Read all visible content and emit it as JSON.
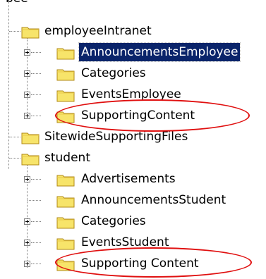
{
  "tree": {
    "top_fragment": "bee",
    "nodes": [
      {
        "label": "employeeIntranet",
        "level": 0,
        "expandable": false
      },
      {
        "label": "AnnouncementsEmployee",
        "level": 1,
        "expandable": true,
        "selected": true
      },
      {
        "label": "Categories",
        "level": 1,
        "expandable": true
      },
      {
        "label": "EventsEmployee",
        "level": 1,
        "expandable": true
      },
      {
        "label": "SupportingContent",
        "level": 1,
        "expandable": true,
        "highlighted": true
      },
      {
        "label": "SitewideSupportingFiles",
        "level": 0,
        "expandable": false
      },
      {
        "label": "student",
        "level": 0,
        "expandable": false
      },
      {
        "label": "Advertisements",
        "level": 1,
        "expandable": true
      },
      {
        "label": "AnnouncementsStudent",
        "level": 1,
        "expandable": false
      },
      {
        "label": "Categories",
        "level": 1,
        "expandable": true
      },
      {
        "label": "EventsStudent",
        "level": 1,
        "expandable": true
      },
      {
        "label": "Supporting Content",
        "level": 1,
        "expandable": true,
        "highlighted": true
      }
    ]
  },
  "colors": {
    "selection_bg": "#0a246a",
    "annotation_ellipse": "#e01010",
    "folder_fill": "#f7e46a",
    "folder_stroke": "#b08a16"
  },
  "icons": {
    "folder": "folder-icon",
    "expand": "plus-expander-icon"
  }
}
